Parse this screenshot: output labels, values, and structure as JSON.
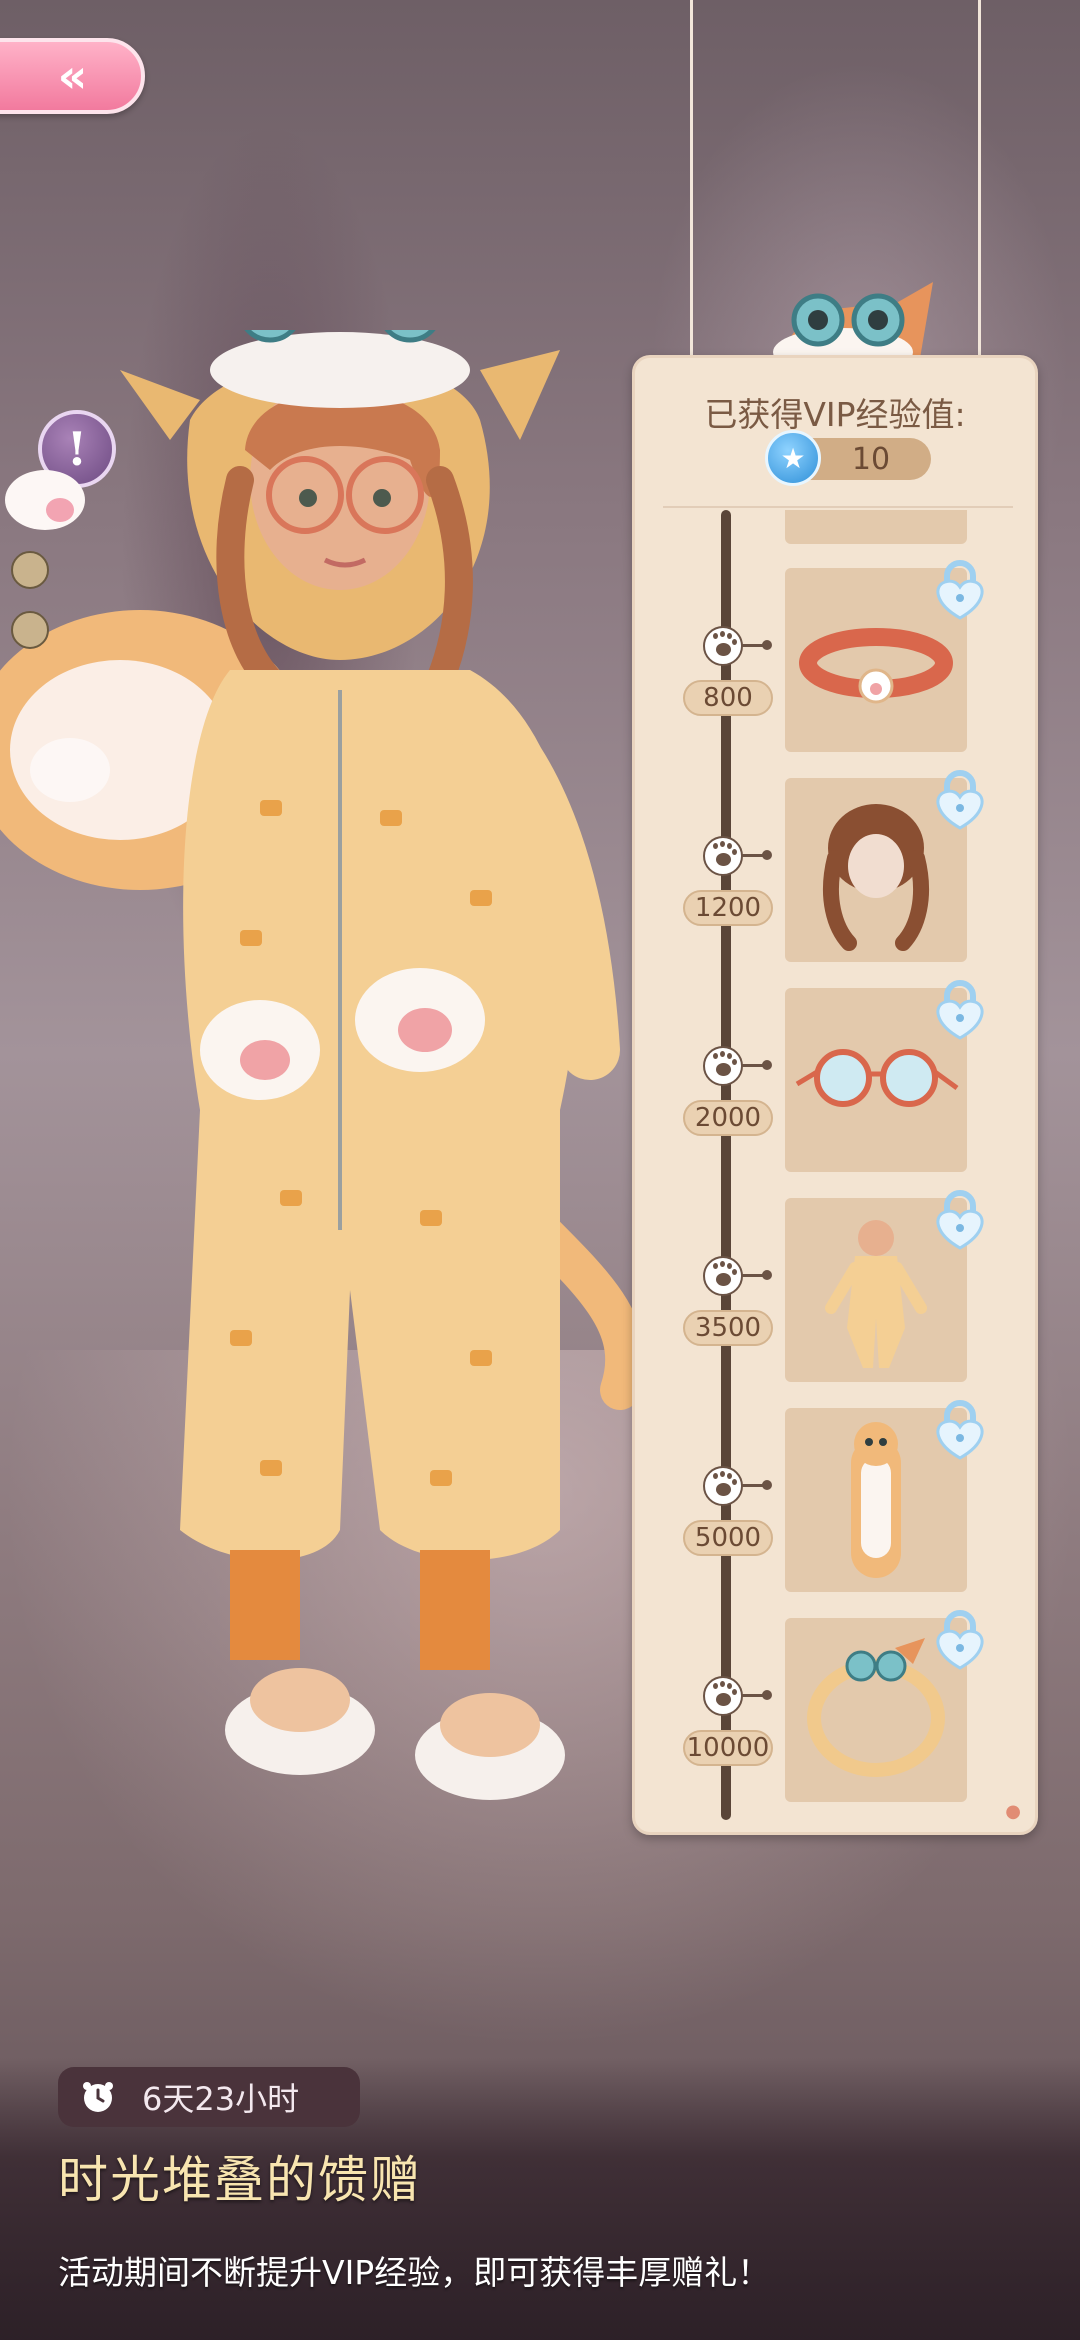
{
  "header": {
    "back_icon": "double-chevron-left-icon",
    "info_icon": "exclamation-icon"
  },
  "panel": {
    "title": "已获得VIP经验值:",
    "exp_icon": "star-icon",
    "exp_value": "10",
    "tiers": [
      {
        "label": "800",
        "item": "cat-collar",
        "locked": true
      },
      {
        "label": "1200",
        "item": "braided-hairstyle",
        "locked": true
      },
      {
        "label": "2000",
        "item": "cat-eye-glasses",
        "locked": true
      },
      {
        "label": "3500",
        "item": "cat-onesie-outfit",
        "locked": true
      },
      {
        "label": "5000",
        "item": "cat-body-pillow",
        "locked": true
      },
      {
        "label": "10000",
        "item": "cat-ring-frame",
        "locked": true
      }
    ]
  },
  "event": {
    "timer": "6天23小时",
    "title": "时光堆叠的馈赠",
    "description": "活动期间不断提升VIP经验，即可获得丰厚赠礼！"
  },
  "colors": {
    "accent_pink": "#f27a9e",
    "panel_bg": "#f3e4d2",
    "title_gold": "#f8e5b0",
    "lock_blue": "#bfe0f7"
  }
}
